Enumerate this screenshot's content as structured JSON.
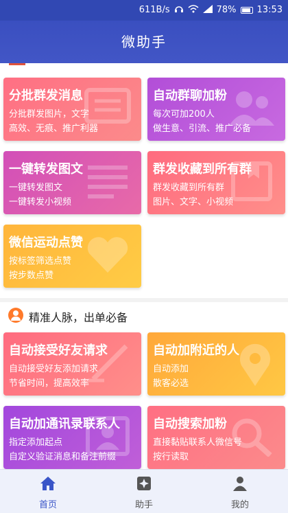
{
  "status": {
    "speed": "611B/s",
    "battery": "78%",
    "time": "13:53"
  },
  "app": {
    "title": "微助手"
  },
  "cards": [
    {
      "title": "分批群发消息",
      "line1": "分批群发图片，文字",
      "line2": "高效、无痕、推广利器"
    },
    {
      "title": "自动群聊加粉",
      "line1": "每次可加200人",
      "line2": "做生意、引流、推广必备"
    },
    {
      "title": "一键转发图文",
      "line1": "一键转发图文",
      "line2": "一键转发小视频"
    },
    {
      "title": "群发收藏到所有群",
      "line1": "群发收藏到所有群",
      "line2": "图片、文字、小视频"
    },
    {
      "title": "微信运动点赞",
      "line1": "按标签筛选点赞",
      "line2": "按步数点赞"
    },
    {
      "title": "自动接受好友请求",
      "line1": "自动接受好友添加请求",
      "line2": "节省时间，提高效率"
    },
    {
      "title": "自动加附近的人",
      "line1": "自动添加",
      "line2": "散客必选"
    },
    {
      "title": "自动加通讯录联系人",
      "line1": "指定添加起点",
      "line2": "自定义验证消息和备注前缀"
    },
    {
      "title": "自动搜索加粉",
      "line1": "直接黏贴联系人微信号",
      "line2": "按行读取"
    }
  ],
  "section": {
    "title": "精准人脉，出单必备"
  },
  "tabs": [
    {
      "label": "首页"
    },
    {
      "label": "助手"
    },
    {
      "label": "我的"
    }
  ],
  "colors": {
    "primary": "#3a4fc0",
    "tab_active": "#3a55c8"
  }
}
